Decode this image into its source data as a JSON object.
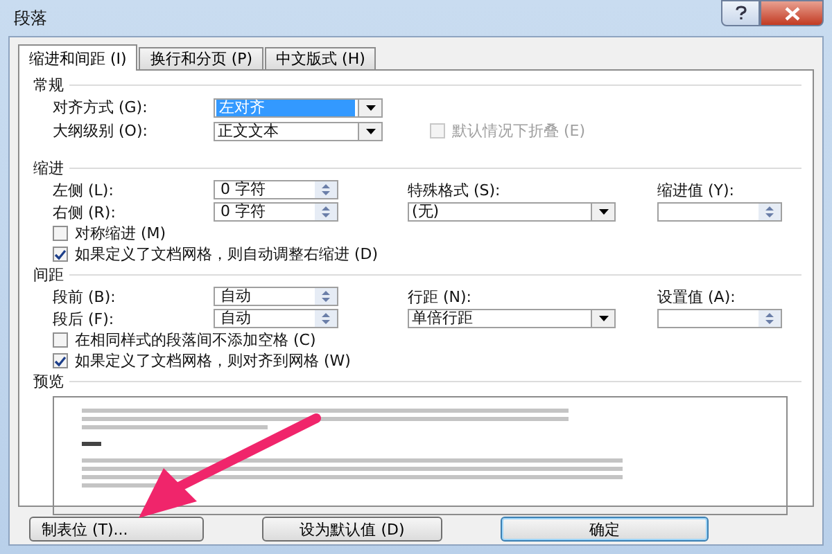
{
  "window": {
    "title": "段落"
  },
  "tabs": [
    {
      "label": "缩进和间距 (I)",
      "selected": true
    },
    {
      "label": "换行和分页 (P)",
      "selected": false
    },
    {
      "label": "中文版式 (H)",
      "selected": false
    }
  ],
  "general": {
    "heading": "常规",
    "alignment": {
      "label": "对齐方式 (G):",
      "value": "左对齐",
      "highlighted": true
    },
    "outline_level": {
      "label": "大纲级别 (O):",
      "value": "正文文本",
      "highlighted": false
    },
    "collapse": {
      "label": "默认情况下折叠 (E)",
      "checked": false,
      "disabled": true
    }
  },
  "indent": {
    "heading": "缩进",
    "left": {
      "label": "左侧 (L):",
      "value": "0 字符"
    },
    "right": {
      "label": "右侧 (R):",
      "value": "0 字符"
    },
    "special": {
      "label": "特殊格式 (S):",
      "value": "(无)"
    },
    "by": {
      "label": "缩进值 (Y):"
    },
    "options": [
      {
        "label": "对称缩进 (M)",
        "checked": false
      },
      {
        "label": "如果定义了文档网格，则自动调整右缩进 (D)",
        "checked": true
      }
    ]
  },
  "spacing": {
    "heading": "间距",
    "before": {
      "label": "段前 (B):",
      "value": "自动"
    },
    "after": {
      "label": "段后 (F):",
      "value": "自动"
    },
    "line": {
      "label": "行距 (N):",
      "value": "单倍行距"
    },
    "at": {
      "label": "设置值 (A):"
    },
    "options": [
      {
        "label": "在相同样式的段落间不添加空格 (C)",
        "checked": false
      },
      {
        "label": "如果定义了文档网格，则对齐到网格 (W)",
        "checked": true
      }
    ]
  },
  "preview": {
    "heading": "预览"
  },
  "buttons": [
    {
      "label": "制表位 (T)...",
      "default": false
    },
    {
      "label": "设为默认值 (D)",
      "default": false
    },
    {
      "label": "确定",
      "default": true
    }
  ]
}
